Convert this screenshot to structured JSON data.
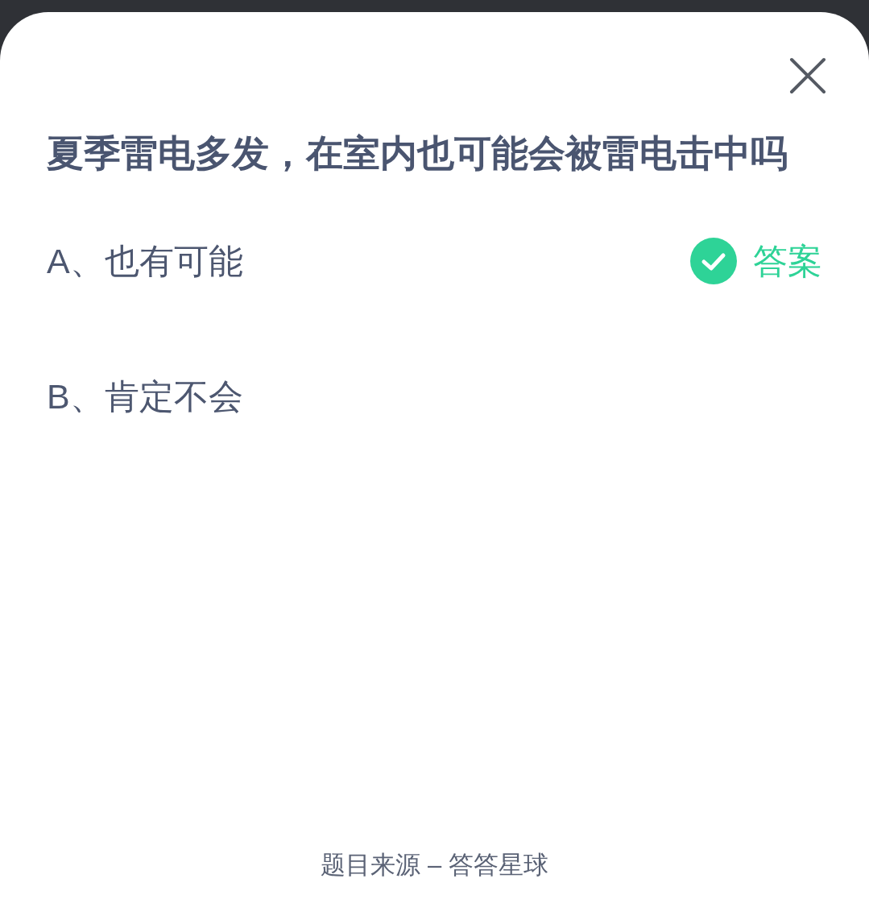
{
  "question": "夏季雷电多发，在室内也可能会被雷电击中吗",
  "options": [
    {
      "text": "A、也有可能",
      "correct": true
    },
    {
      "text": "B、肯定不会",
      "correct": false
    }
  ],
  "answer_label": "答案",
  "footer": "题目来源 – 答答星球"
}
